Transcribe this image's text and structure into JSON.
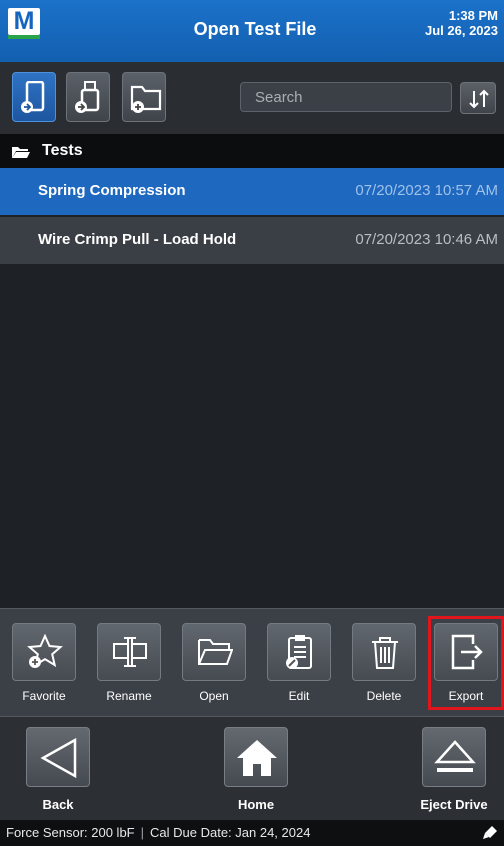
{
  "header": {
    "logo_letter": "M",
    "title": "Open Test File",
    "time": "1:38 PM",
    "date": "Jul 26, 2023"
  },
  "toolbar": {
    "devices": [
      {
        "name": "internal-storage",
        "active": true
      },
      {
        "name": "usb-drive",
        "active": false
      },
      {
        "name": "new-folder",
        "active": false
      }
    ],
    "search_placeholder": "Search"
  },
  "folder": {
    "label": "Tests"
  },
  "files": [
    {
      "name": "Spring Compression",
      "date": "07/20/2023 10:57 AM",
      "selected": true
    },
    {
      "name": "Wire Crimp Pull - Load Hold",
      "date": "07/20/2023 10:46 AM",
      "selected": false
    }
  ],
  "actions": [
    {
      "label": "Favorite",
      "icon": "star-plus-icon"
    },
    {
      "label": "Rename",
      "icon": "rename-icon"
    },
    {
      "label": "Open",
      "icon": "open-folder-icon"
    },
    {
      "label": "Edit",
      "icon": "clipboard-edit-icon"
    },
    {
      "label": "Delete",
      "icon": "trash-icon"
    },
    {
      "label": "Export",
      "icon": "export-icon"
    }
  ],
  "nav": {
    "back_label": "Back",
    "home_label": "Home",
    "eject_label": "Eject Drive"
  },
  "status": {
    "sensor": "Force Sensor: 200 lbF",
    "separator": "|",
    "cal_due": "Cal Due Date: Jan 24, 2024"
  },
  "colors": {
    "accent": "#1e68c0",
    "highlight_box": "#e0161c",
    "brand_green": "#2aa34a"
  }
}
